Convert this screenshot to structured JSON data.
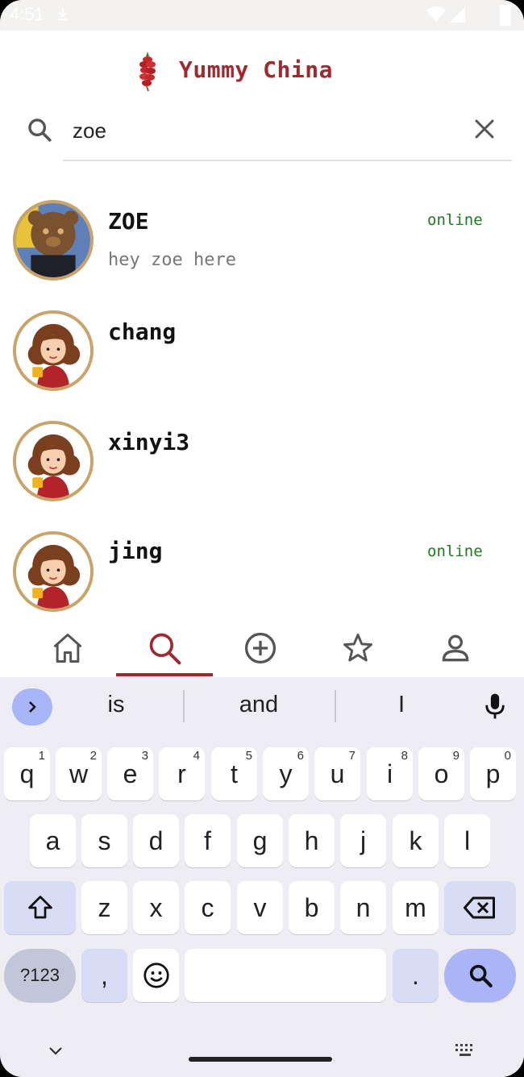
{
  "status_bar": {
    "time": "4:51"
  },
  "header": {
    "title": "Yummy China"
  },
  "search": {
    "value": "zoe",
    "placeholder": ""
  },
  "chats": [
    {
      "name": "ZOE",
      "message": "hey zoe here",
      "status": "online",
      "avatar": "teddy-bear-avatar"
    },
    {
      "name": "chang",
      "message": "",
      "status": "",
      "avatar": "girl-avatar"
    },
    {
      "name": "xinyi3",
      "message": "",
      "status": "",
      "avatar": "girl-avatar"
    },
    {
      "name": "jing",
      "message": "",
      "status": "online",
      "avatar": "girl-avatar"
    }
  ],
  "bottom_nav": {
    "items": [
      "home-icon",
      "search-icon",
      "add-circle-icon",
      "star-icon",
      "person-icon"
    ],
    "active_index": 1
  },
  "keyboard": {
    "suggestions": [
      "is",
      "and",
      "I"
    ],
    "row1": [
      "q",
      "w",
      "e",
      "r",
      "t",
      "y",
      "u",
      "i",
      "o",
      "p"
    ],
    "row1_hints": [
      "1",
      "2",
      "3",
      "4",
      "5",
      "6",
      "7",
      "8",
      "9",
      "0"
    ],
    "row2": [
      "a",
      "s",
      "d",
      "f",
      "g",
      "h",
      "j",
      "k",
      "l"
    ],
    "row3": [
      "z",
      "x",
      "c",
      "v",
      "b",
      "n",
      "m"
    ],
    "symbols_label": "?123",
    "comma": ",",
    "period": "."
  },
  "colors": {
    "brand": "#9e2a2f",
    "online": "#1f7a1f",
    "avatar_border": "#c8a46a",
    "keyboard_accent": "#a9b5f7"
  }
}
